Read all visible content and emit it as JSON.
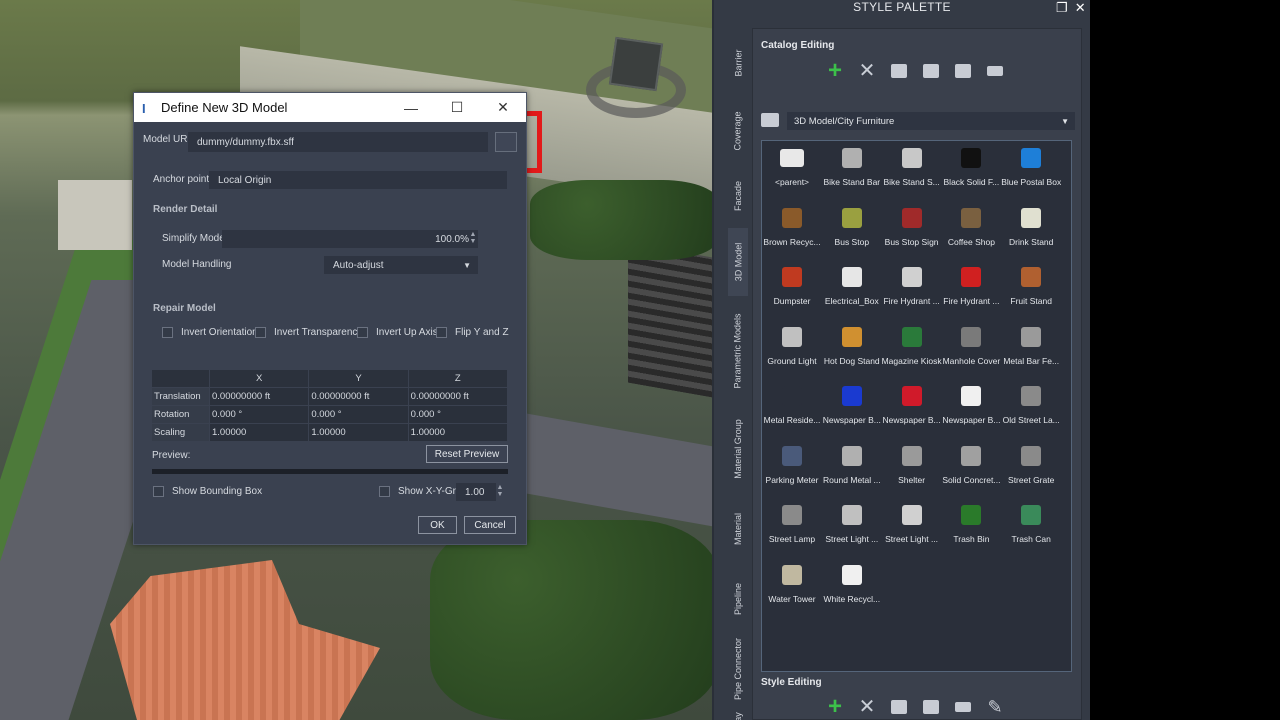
{
  "dialog": {
    "title": "Define New 3D Model",
    "model_uri_label": "Model URI:",
    "model_uri_value": "dummy/dummy.fbx.sff",
    "anchor_label": "Anchor point:",
    "anchor_value": "Local Origin",
    "render_detail_title": "Render Detail",
    "simplify_label": "Simplify Model",
    "simplify_value": "100.0%",
    "handling_label": "Model Handling",
    "handling_value": "Auto-adjust",
    "repair_title": "Repair Model",
    "repair_options": [
      "Invert Orientation",
      "Invert Transparency",
      "Invert Up Axis",
      "Flip Y and Z"
    ],
    "table": {
      "columns": [
        "",
        "X",
        "Y",
        "Z"
      ],
      "rows": [
        {
          "label": "Translation",
          "x": "0.00000000 ft",
          "y": "0.00000000 ft",
          "z": "0.00000000 ft"
        },
        {
          "label": "Rotation",
          "x": "0.000 °",
          "y": "0.000 °",
          "z": "0.000 °"
        },
        {
          "label": "Scaling",
          "x": "1.00000",
          "y": "1.00000",
          "z": "1.00000"
        }
      ]
    },
    "preview_label": "Preview:",
    "reset_preview": "Reset Preview",
    "show_bbox": "Show Bounding Box",
    "show_grid": "Show X-Y-Grid",
    "grid_value": "1.00",
    "ok": "OK",
    "cancel": "Cancel"
  },
  "palette": {
    "title": "STYLE PALETTE",
    "side_tabs": [
      "Barrier",
      "Coverage",
      "Facade",
      "3D Model",
      "Parametric Models",
      "Material Group",
      "Material",
      "Pipeline",
      "Pipe Connector",
      "ay"
    ],
    "active_tab": "3D Model",
    "catalog_editing": "Catalog Editing",
    "style_editing": "Style Editing",
    "catalog": "3D Model/City Furniture",
    "items": [
      {
        "name": "<parent>",
        "color": "#e8e8e8"
      },
      {
        "name": "Bike Stand Bar",
        "color": "#b0b0b0"
      },
      {
        "name": "Bike Stand S...",
        "color": "#c8c8c8"
      },
      {
        "name": "Black Solid F...",
        "color": "#111111"
      },
      {
        "name": "Blue Postal Box",
        "color": "#1e7fd8"
      },
      {
        "name": "Brown Recyc...",
        "color": "#8a5a2a"
      },
      {
        "name": "Bus Stop",
        "color": "#9aa040"
      },
      {
        "name": "Bus Stop Sign",
        "color": "#a02a2a"
      },
      {
        "name": "Coffee Shop",
        "color": "#7a6040"
      },
      {
        "name": "Drink Stand",
        "color": "#e0e0d0"
      },
      {
        "name": "Dumpster",
        "color": "#c03a20"
      },
      {
        "name": "Electrical_Box",
        "color": "#e6e6e6"
      },
      {
        "name": "Fire Hydrant ...",
        "color": "#d0d0d0"
      },
      {
        "name": "Fire Hydrant ...",
        "color": "#d02020"
      },
      {
        "name": "Fruit Stand",
        "color": "#b06030"
      },
      {
        "name": "Ground Light",
        "color": "#c0c0c0"
      },
      {
        "name": "Hot Dog Stand",
        "color": "#d09030"
      },
      {
        "name": "Magazine Kiosk",
        "color": "#2a7a3a"
      },
      {
        "name": "Manhole Cover",
        "color": "#7a7a7a"
      },
      {
        "name": "Metal Bar Fe...",
        "color": "#9a9a9a"
      },
      {
        "name": "Metal Reside...",
        "color": "#2a2f3a"
      },
      {
        "name": "Newspaper B...",
        "color": "#1a3ad0"
      },
      {
        "name": "Newspaper B...",
        "color": "#d01a2a"
      },
      {
        "name": "Newspaper B...",
        "color": "#f0f0f0"
      },
      {
        "name": "Old Street La...",
        "color": "#8a8a8a"
      },
      {
        "name": "Parking Meter",
        "color": "#4a5a7a"
      },
      {
        "name": "Round Metal ...",
        "color": "#b0b0b0"
      },
      {
        "name": "Shelter",
        "color": "#9a9a9a"
      },
      {
        "name": "Solid Concret...",
        "color": "#a0a0a0"
      },
      {
        "name": "Street Grate",
        "color": "#8a8a8a"
      },
      {
        "name": "Street Lamp",
        "color": "#8a8a8a"
      },
      {
        "name": "Street Light ...",
        "color": "#c0c0c0"
      },
      {
        "name": "Street Light ...",
        "color": "#d0d0d0"
      },
      {
        "name": "Trash Bin",
        "color": "#2a7a2a"
      },
      {
        "name": "Trash Can",
        "color": "#3a8a5a"
      },
      {
        "name": "Water Tower",
        "color": "#c0b8a0"
      },
      {
        "name": "White Recycl...",
        "color": "#f0f0f0"
      }
    ]
  }
}
